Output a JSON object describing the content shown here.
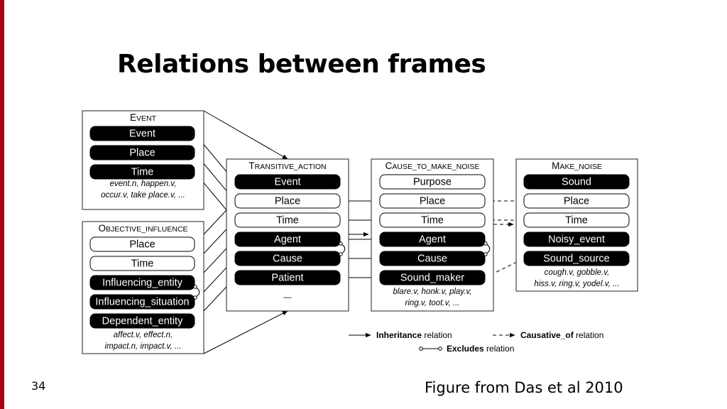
{
  "slide": {
    "title": "Relations between frames",
    "page_number": "34",
    "caption": "Figure from Das et al 2010",
    "accent_color": "#a50012"
  },
  "frames": {
    "event": {
      "title": "Event",
      "elements": [
        {
          "label": "Event",
          "core": true
        },
        {
          "label": "Place",
          "core": true
        },
        {
          "label": "Time",
          "core": true
        }
      ],
      "lexical_units": [
        "event.n, happen.v,",
        "occur.v, take place.v, ..."
      ]
    },
    "objective_influence": {
      "title": "Objective_influence",
      "elements": [
        {
          "label": "Place",
          "core": false
        },
        {
          "label": "Time",
          "core": false
        },
        {
          "label": "Influencing_entity",
          "core": true
        },
        {
          "label": "Influencing_situation",
          "core": true
        },
        {
          "label": "Dependent_entity",
          "core": true
        }
      ],
      "lexical_units": [
        "affect.v, effect.n,",
        "impact.n, impact.v, ..."
      ]
    },
    "transitive_action": {
      "title": "Transitive_action",
      "elements": [
        {
          "label": "Event",
          "core": true
        },
        {
          "label": "Place",
          "core": false
        },
        {
          "label": "Time",
          "core": false
        },
        {
          "label": "Agent",
          "core": true
        },
        {
          "label": "Cause",
          "core": true
        },
        {
          "label": "Patient",
          "core": true
        }
      ],
      "lexical_units": [
        "—"
      ]
    },
    "cause_to_make_noise": {
      "title": "Cause_to_make_noise",
      "elements": [
        {
          "label": "Purpose",
          "core": false
        },
        {
          "label": "Place",
          "core": false
        },
        {
          "label": "Time",
          "core": false
        },
        {
          "label": "Agent",
          "core": true
        },
        {
          "label": "Cause",
          "core": true
        },
        {
          "label": "Sound_maker",
          "core": true
        }
      ],
      "lexical_units": [
        "blare.v, honk.v, play.v,",
        "ring.v, toot.v, ..."
      ]
    },
    "make_noise": {
      "title": "Make_noise",
      "elements": [
        {
          "label": "Sound",
          "core": true
        },
        {
          "label": "Place",
          "core": false
        },
        {
          "label": "Time",
          "core": false
        },
        {
          "label": "Noisy_event",
          "core": true
        },
        {
          "label": "Sound_source",
          "core": true
        }
      ],
      "lexical_units": [
        "cough.v, gobble.v,",
        "hiss.v, ring.v, yodel.v, ..."
      ]
    }
  },
  "relations": [
    {
      "type": "inheritance",
      "from": "event",
      "to": "transitive_action"
    },
    {
      "type": "inheritance",
      "from": "objective_influence",
      "to": "transitive_action"
    },
    {
      "type": "inheritance",
      "from": "transitive_action",
      "to": "cause_to_make_noise"
    },
    {
      "type": "causative_of",
      "from": "cause_to_make_noise",
      "to": "make_noise"
    }
  ],
  "legend": {
    "inheritance": {
      "bold": "Inheritance",
      "rest": " relation"
    },
    "causative": {
      "bold": "Causative_of",
      "rest": " relation"
    },
    "excludes": {
      "bold": "Excludes",
      "rest": " relation"
    }
  }
}
